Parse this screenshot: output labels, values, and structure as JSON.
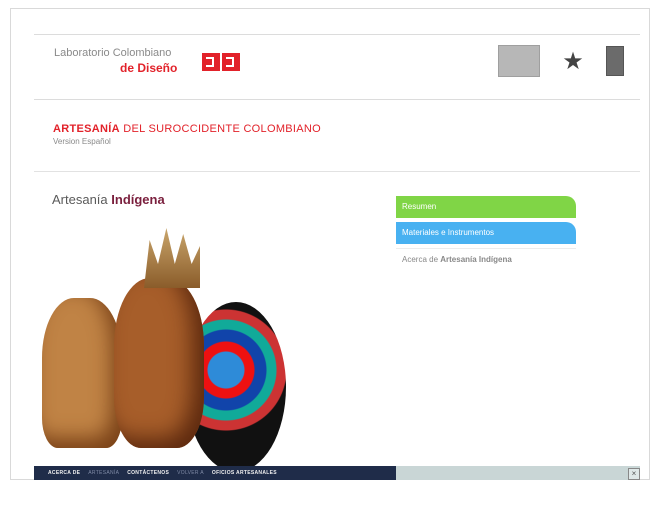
{
  "header": {
    "brand_line1": "Laboratorio Colombiano",
    "brand_line2": "de Diseño"
  },
  "title_block": {
    "title_bold": "ARTESANÍA",
    "title_rest": " DEL SUROCCIDENTE COLOMBIANO",
    "subtitle": "Version Español"
  },
  "section": {
    "heading_normal": "Artesanía ",
    "heading_bold": "Indígena"
  },
  "menu": {
    "items": [
      {
        "label": "Resumen"
      },
      {
        "label": "Materiales e Instrumentos"
      },
      {
        "label_prefix": "Acerca de ",
        "label_bold": "Artesanía Indígena"
      }
    ]
  },
  "footer_nav": {
    "acerca": "ACERCA DE",
    "acerca_dim": "ARTESANÍA",
    "contactenos": "CONTÁCTENOS",
    "volver_dim": "VOLVER A",
    "oficios": "OFICIOS ARTESANALES",
    "close_symbol": "×"
  },
  "colors": {
    "accent_red": "#e2222a",
    "menu_green": "#80d546",
    "menu_blue": "#48b1f1",
    "footer_navy": "#1f2c49"
  },
  "icons": [
    "logo-icon",
    "flag-icon",
    "figure-icon",
    "seal-icon",
    "close-icon"
  ]
}
